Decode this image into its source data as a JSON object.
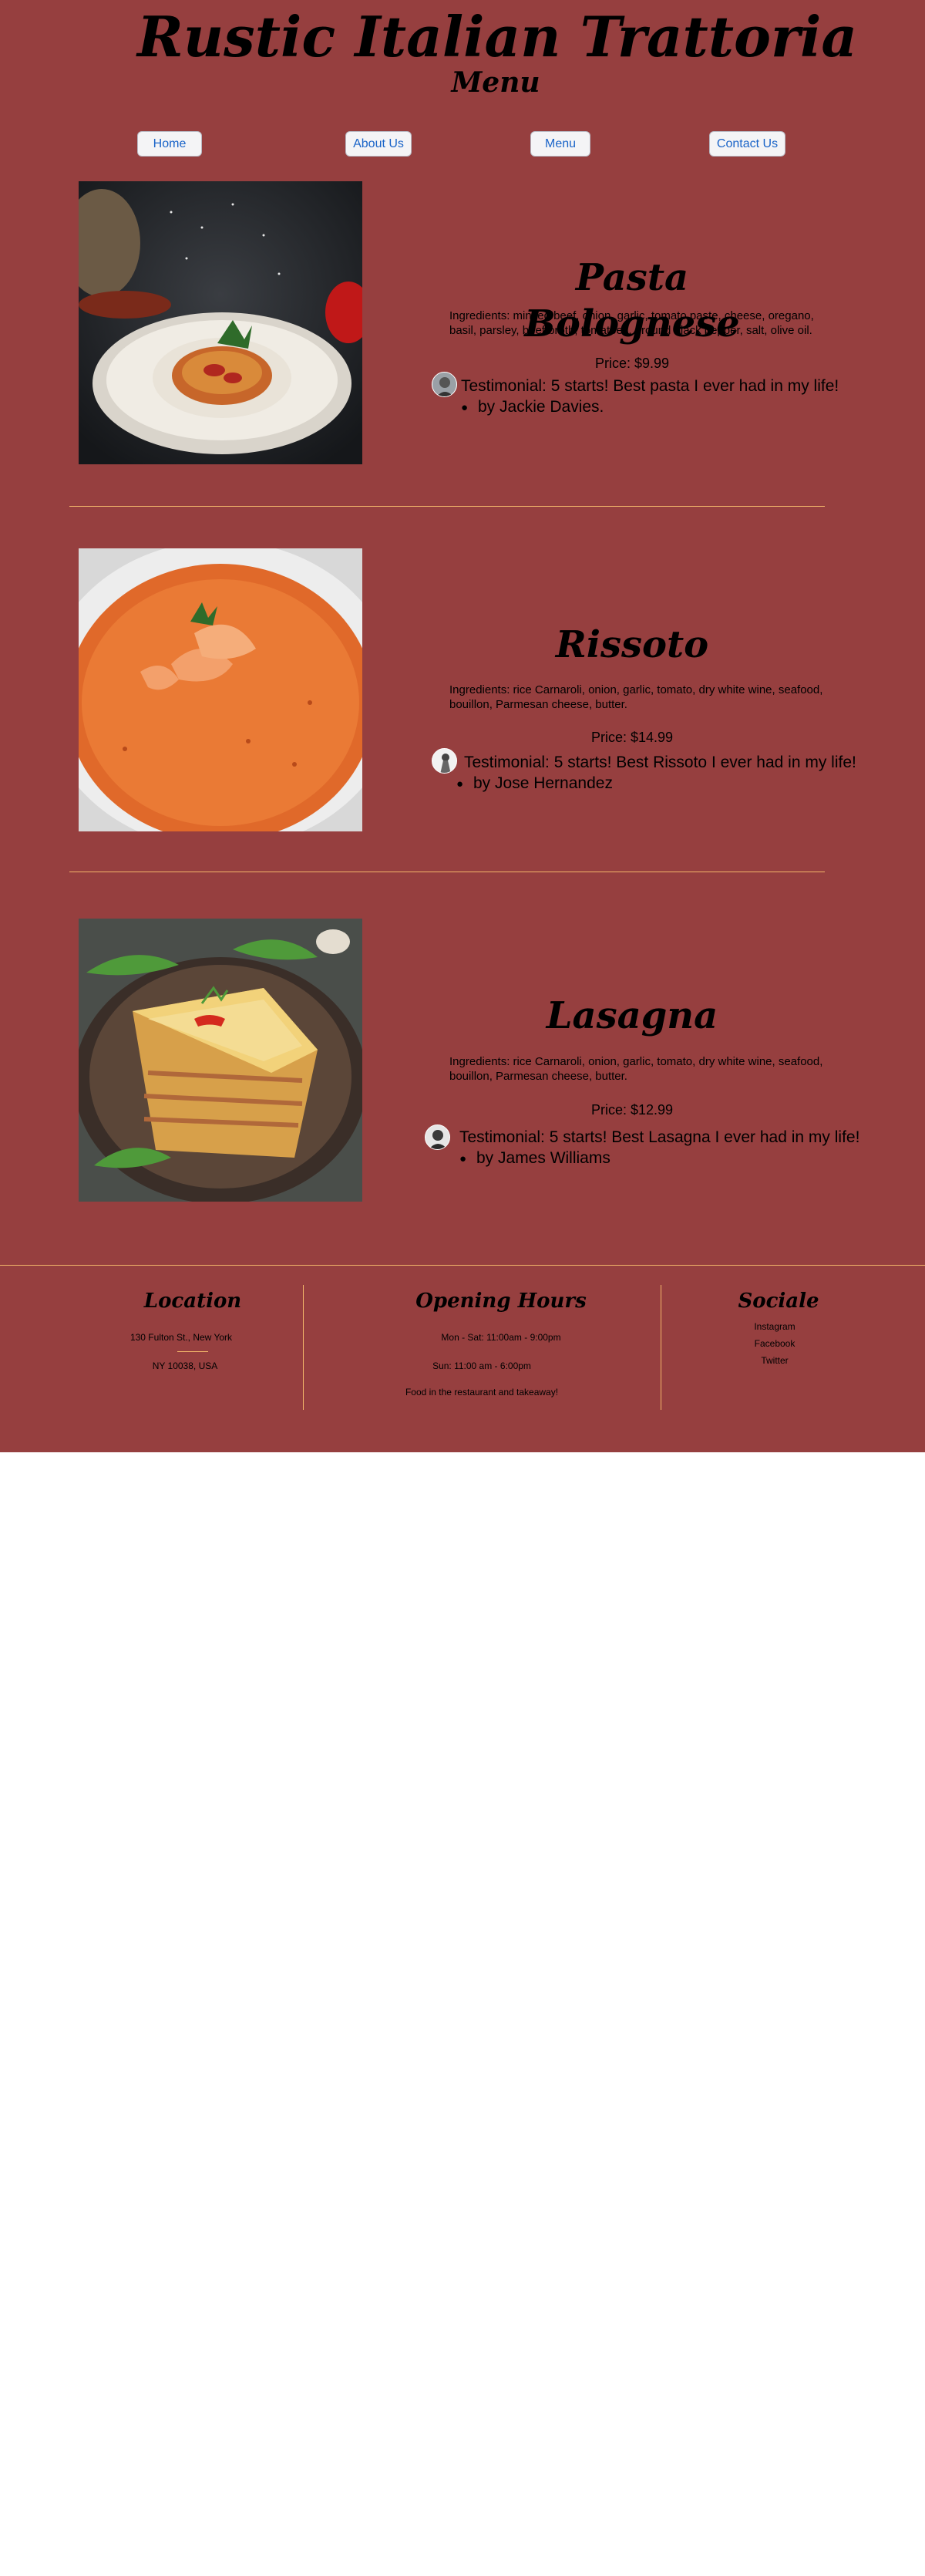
{
  "header": {
    "title": "Rustic Italian Trattoria",
    "subtitle": "Menu"
  },
  "nav": {
    "items": [
      {
        "label": "Home"
      },
      {
        "label": "About Us"
      },
      {
        "label": "Menu"
      },
      {
        "label": "Contact Us"
      }
    ]
  },
  "dishes": [
    {
      "name": "Pasta Bolognese",
      "ingredients": "Ingredients: minced beef, onion, garlic, tomato paste, cheese, oregano, basil, parsley, beef broth, tomatoes, ground black pepper, salt, olive oil.",
      "price": "Price: $9.99",
      "testimonial": "Testimonial: 5 starts! Best pasta I ever had in my life!",
      "author": "by Jackie Davies."
    },
    {
      "name": "Rissoto",
      "ingredients": "Ingredients: rice Carnaroli, onion, garlic, tomato, dry white wine, seafood, bouillon, Parmesan cheese, butter.",
      "price": "Price: $14.99",
      "testimonial": "Testimonial: 5 starts! Best Rissoto  I ever had in my life!",
      "author": "by Jose Hernandez"
    },
    {
      "name": "Lasagna",
      "ingredients": "Ingredients: rice Carnaroli, onion, garlic, tomato, dry white wine, seafood, bouillon, Parmesan cheese, butter.",
      "price": "Price: $12.99",
      "testimonial": "Testimonial: 5 starts! Best Lasagna I ever had in my life!",
      "author": "by James Williams"
    }
  ],
  "footer": {
    "location": {
      "heading": "Location",
      "line1": "130 Fulton St., New York",
      "line2": "NY 10038, USA"
    },
    "hours": {
      "heading": "Opening Hours",
      "weekdays": "Mon - Sat: 11:00am - 9:00pm",
      "sunday": "Sun: 11:00 am - 6:00pm",
      "note": "Food in the restaurant and takeaway!"
    },
    "social": {
      "heading": "Sociale",
      "links": [
        "Instagram",
        "Facebook",
        "Twitter"
      ]
    }
  },
  "colors": {
    "background": "#963f3f",
    "divider": "#f2b66a",
    "link": "#1a64c8"
  }
}
